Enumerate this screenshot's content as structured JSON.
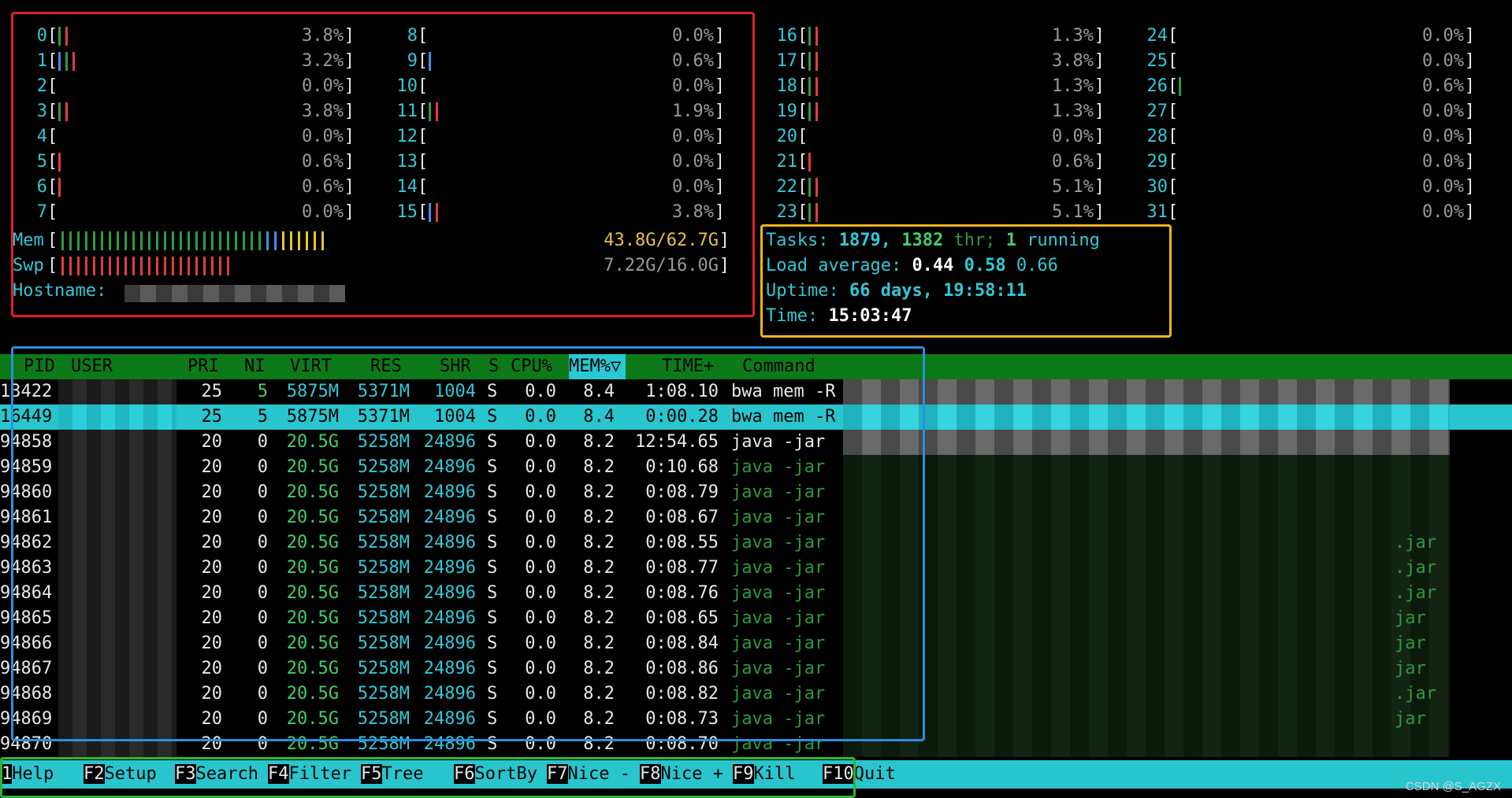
{
  "cpus": [
    {
      "id": "0",
      "pct": "3.8%",
      "bars": [
        "dkgreen",
        "red"
      ]
    },
    {
      "id": "1",
      "pct": "3.2%",
      "bars": [
        "blue",
        "dkgreen",
        "red"
      ]
    },
    {
      "id": "2",
      "pct": "0.0%",
      "bars": []
    },
    {
      "id": "3",
      "pct": "3.8%",
      "bars": [
        "dkgreen",
        "red"
      ]
    },
    {
      "id": "4",
      "pct": "0.0%",
      "bars": []
    },
    {
      "id": "5",
      "pct": "0.6%",
      "bars": [
        "red"
      ]
    },
    {
      "id": "6",
      "pct": "0.6%",
      "bars": [
        "red"
      ]
    },
    {
      "id": "7",
      "pct": "0.0%",
      "bars": []
    },
    {
      "id": "8",
      "pct": "0.0%",
      "bars": []
    },
    {
      "id": "9",
      "pct": "0.6%",
      "bars": [
        "blue"
      ]
    },
    {
      "id": "10",
      "pct": "0.0%",
      "bars": []
    },
    {
      "id": "11",
      "pct": "1.9%",
      "bars": [
        "dkgreen",
        "red"
      ]
    },
    {
      "id": "12",
      "pct": "0.0%",
      "bars": []
    },
    {
      "id": "13",
      "pct": "0.0%",
      "bars": []
    },
    {
      "id": "14",
      "pct": "0.0%",
      "bars": []
    },
    {
      "id": "15",
      "pct": "3.8%",
      "bars": [
        "blue",
        "red"
      ]
    },
    {
      "id": "16",
      "pct": "1.3%",
      "bars": [
        "dkgreen",
        "red"
      ]
    },
    {
      "id": "17",
      "pct": "3.8%",
      "bars": [
        "dkgreen",
        "red"
      ]
    },
    {
      "id": "18",
      "pct": "1.3%",
      "bars": [
        "dkgreen",
        "red"
      ]
    },
    {
      "id": "19",
      "pct": "1.3%",
      "bars": [
        "dkgreen",
        "red"
      ]
    },
    {
      "id": "20",
      "pct": "0.0%",
      "bars": []
    },
    {
      "id": "21",
      "pct": "0.6%",
      "bars": [
        "red"
      ]
    },
    {
      "id": "22",
      "pct": "5.1%",
      "bars": [
        "dkgreen",
        "red"
      ]
    },
    {
      "id": "23",
      "pct": "5.1%",
      "bars": [
        "dkgreen",
        "red"
      ]
    },
    {
      "id": "24",
      "pct": "0.0%",
      "bars": []
    },
    {
      "id": "25",
      "pct": "0.0%",
      "bars": []
    },
    {
      "id": "26",
      "pct": "0.6%",
      "bars": [
        "dkgreen"
      ]
    },
    {
      "id": "27",
      "pct": "0.0%",
      "bars": []
    },
    {
      "id": "28",
      "pct": "0.0%",
      "bars": []
    },
    {
      "id": "29",
      "pct": "0.0%",
      "bars": []
    },
    {
      "id": "30",
      "pct": "0.0%",
      "bars": []
    },
    {
      "id": "31",
      "pct": "0.0%",
      "bars": []
    }
  ],
  "mem": {
    "label": "Mem",
    "value": "43.8G/62.7G",
    "fraction": 0.7
  },
  "swp": {
    "label": "Swp",
    "value": "7.22G/16.0G",
    "fraction": 0.45
  },
  "hostname_label": "Hostname:",
  "tasks": {
    "label": "Tasks:",
    "count": "1879,",
    "thr_count": "1382",
    "thr_label": "thr;",
    "running_count": "1",
    "running_label": "running"
  },
  "load": {
    "label": "Load average:",
    "one": "0.44",
    "five": "0.58",
    "fifteen": "0.66"
  },
  "uptime": {
    "label": "Uptime:",
    "value": "66 days, 19:58:11"
  },
  "time": {
    "label": "Time:",
    "value": "15:03:47"
  },
  "columns": {
    "pid": "PID",
    "user": "USER",
    "pri": "PRI",
    "ni": "NI",
    "virt": "VIRT",
    "res": "RES",
    "shr": "SHR",
    "s": "S",
    "cpu": "CPU%",
    "mem": "MEM%▽",
    "time": "TIME+",
    "command": "Command"
  },
  "processes": [
    {
      "pid": "13422",
      "pri": "25",
      "ni": "5",
      "virt": "5875M",
      "res": "5371M",
      "shr": "1004",
      "s": "S",
      "cpu": "0.0",
      "mem": "8.4",
      "time": "1:08.10",
      "cmd": "bwa mem -R",
      "style": "bwa"
    },
    {
      "pid": "16449",
      "pri": "25",
      "ni": "5",
      "virt": "5875M",
      "res": "5371M",
      "shr": "1004",
      "s": "S",
      "cpu": "0.0",
      "mem": "8.4",
      "time": "0:00.28",
      "cmd": "bwa mem -R",
      "style": "selected"
    },
    {
      "pid": "94858",
      "pri": "20",
      "ni": "0",
      "virt": "20.5G",
      "res": "5258M",
      "shr": "24896",
      "s": "S",
      "cpu": "0.0",
      "mem": "8.2",
      "time": "12:54.65",
      "cmd": "java -jar",
      "style": "java-main"
    },
    {
      "pid": "94859",
      "pri": "20",
      "ni": "0",
      "virt": "20.5G",
      "res": "5258M",
      "shr": "24896",
      "s": "S",
      "cpu": "0.0",
      "mem": "8.2",
      "time": "0:10.68",
      "cmd": "java -jar",
      "style": "thread",
      "tail": ""
    },
    {
      "pid": "94860",
      "pri": "20",
      "ni": "0",
      "virt": "20.5G",
      "res": "5258M",
      "shr": "24896",
      "s": "S",
      "cpu": "0.0",
      "mem": "8.2",
      "time": "0:08.79",
      "cmd": "java -jar",
      "style": "thread",
      "tail": ""
    },
    {
      "pid": "94861",
      "pri": "20",
      "ni": "0",
      "virt": "20.5G",
      "res": "5258M",
      "shr": "24896",
      "s": "S",
      "cpu": "0.0",
      "mem": "8.2",
      "time": "0:08.67",
      "cmd": "java -jar",
      "style": "thread",
      "tail": ""
    },
    {
      "pid": "94862",
      "pri": "20",
      "ni": "0",
      "virt": "20.5G",
      "res": "5258M",
      "shr": "24896",
      "s": "S",
      "cpu": "0.0",
      "mem": "8.2",
      "time": "0:08.55",
      "cmd": "java -jar",
      "style": "thread",
      "tail": ".jar"
    },
    {
      "pid": "94863",
      "pri": "20",
      "ni": "0",
      "virt": "20.5G",
      "res": "5258M",
      "shr": "24896",
      "s": "S",
      "cpu": "0.0",
      "mem": "8.2",
      "time": "0:08.77",
      "cmd": "java -jar",
      "style": "thread",
      "tail": ".jar"
    },
    {
      "pid": "94864",
      "pri": "20",
      "ni": "0",
      "virt": "20.5G",
      "res": "5258M",
      "shr": "24896",
      "s": "S",
      "cpu": "0.0",
      "mem": "8.2",
      "time": "0:08.76",
      "cmd": "java -jar",
      "style": "thread",
      "tail": ".jar"
    },
    {
      "pid": "94865",
      "pri": "20",
      "ni": "0",
      "virt": "20.5G",
      "res": "5258M",
      "shr": "24896",
      "s": "S",
      "cpu": "0.0",
      "mem": "8.2",
      "time": "0:08.65",
      "cmd": "java -jar",
      "style": "thread",
      "tail": "jar"
    },
    {
      "pid": "94866",
      "pri": "20",
      "ni": "0",
      "virt": "20.5G",
      "res": "5258M",
      "shr": "24896",
      "s": "S",
      "cpu": "0.0",
      "mem": "8.2",
      "time": "0:08.84",
      "cmd": "java -jar",
      "style": "thread",
      "tail": "jar"
    },
    {
      "pid": "94867",
      "pri": "20",
      "ni": "0",
      "virt": "20.5G",
      "res": "5258M",
      "shr": "24896",
      "s": "S",
      "cpu": "0.0",
      "mem": "8.2",
      "time": "0:08.86",
      "cmd": "java -jar",
      "style": "thread",
      "tail": "jar"
    },
    {
      "pid": "94868",
      "pri": "20",
      "ni": "0",
      "virt": "20.5G",
      "res": "5258M",
      "shr": "24896",
      "s": "S",
      "cpu": "0.0",
      "mem": "8.2",
      "time": "0:08.82",
      "cmd": "java -jar",
      "style": "thread",
      "tail": ".jar"
    },
    {
      "pid": "94869",
      "pri": "20",
      "ni": "0",
      "virt": "20.5G",
      "res": "5258M",
      "shr": "24896",
      "s": "S",
      "cpu": "0.0",
      "mem": "8.2",
      "time": "0:08.73",
      "cmd": "java -jar",
      "style": "thread",
      "tail": "jar"
    },
    {
      "pid": "94870",
      "pri": "20",
      "ni": "0",
      "virt": "20.5G",
      "res": "5258M",
      "shr": "24896",
      "s": "S",
      "cpu": "0.0",
      "mem": "8.2",
      "time": "0:08.70",
      "cmd": "java -jar",
      "style": "thread",
      "tail": ""
    }
  ],
  "fkeys": [
    {
      "key": "1",
      "label": "Help  "
    },
    {
      "key": "F2",
      "label": "Setup "
    },
    {
      "key": "F3",
      "label": "Search"
    },
    {
      "key": "F4",
      "label": "Filter"
    },
    {
      "key": "F5",
      "label": "Tree  "
    },
    {
      "key": "F6",
      "label": "SortBy"
    },
    {
      "key": "F7",
      "label": "Nice -"
    },
    {
      "key": "F8",
      "label": "Nice +"
    },
    {
      "key": "F9",
      "label": "Kill  "
    },
    {
      "key": "F10",
      "label": "Quit"
    }
  ],
  "watermark": "CSDN @S_AGZX"
}
